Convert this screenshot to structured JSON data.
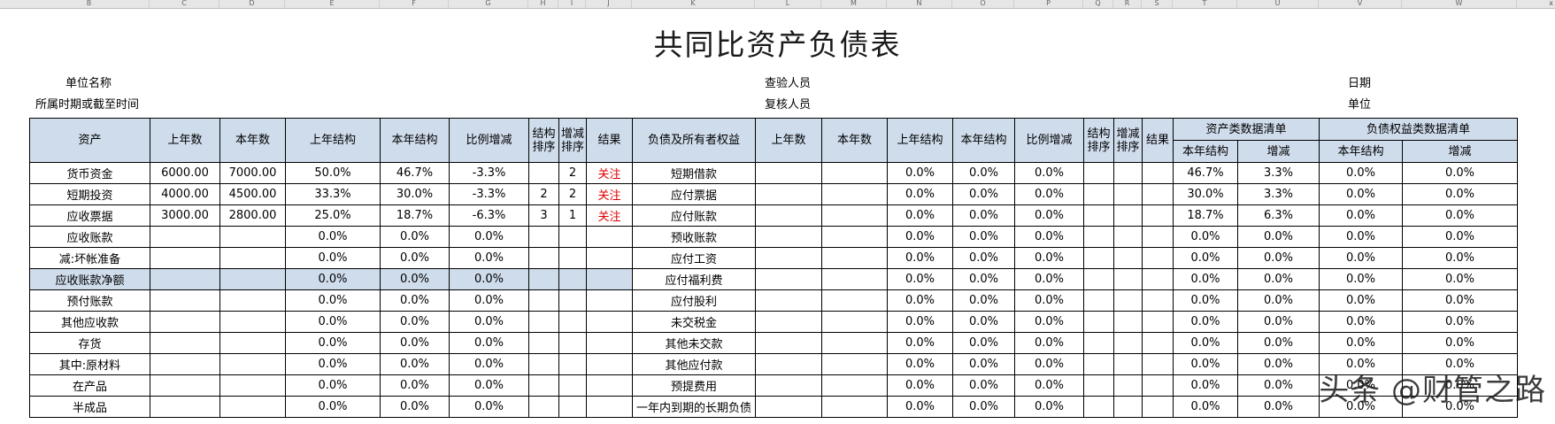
{
  "column_letters": [
    "B",
    "C",
    "D",
    "E",
    "F",
    "G",
    "H",
    "I",
    "J",
    "K",
    "L",
    "M",
    "N",
    "O",
    "P",
    "Q",
    "R",
    "S",
    "T",
    "U",
    "V",
    "W"
  ],
  "close_glyph": "x",
  "title": "共同比资产负债表",
  "meta": {
    "unit_name": "单位名称",
    "period": "所属时期或截至时间",
    "checker": "查验人员",
    "reviewer": "复核人员",
    "date": "日期",
    "unit": "单位"
  },
  "headers": {
    "asset": "资产",
    "prev_amount": "上年数",
    "curr_amount": "本年数",
    "prev_struct": "上年结构",
    "curr_struct": "本年结构",
    "ratio_change": "比例增减",
    "struct_rank": "结构排序",
    "change_rank": "增减排序",
    "result": "结果",
    "liability": "负债及所有者权益",
    "asset_list": "资产类数据清单",
    "liab_list": "负债权益类数据清单",
    "list_struct": "本年结构",
    "list_change": "增减"
  },
  "rows": [
    {
      "asset": "货币资金",
      "prev": "6000.00",
      "curr": "7000.00",
      "ps": "50.0%",
      "cs": "46.7%",
      "chg": "-3.3%",
      "sr": "",
      "cr": "2",
      "res": "关注",
      "liab": "短期借款",
      "lprev": "",
      "lcurr": "",
      "lps": "0.0%",
      "lcs": "0.0%",
      "lchg": "0.0%",
      "lsr": "",
      "lcr": "",
      "lres": "",
      "as": "46.7%",
      "ac": "3.3%",
      "ls": "0.0%",
      "lc": "0.0%"
    },
    {
      "asset": "短期投资",
      "prev": "4000.00",
      "curr": "4500.00",
      "ps": "33.3%",
      "cs": "30.0%",
      "chg": "-3.3%",
      "sr": "2",
      "cr": "2",
      "res": "关注",
      "liab": "应付票据",
      "lprev": "",
      "lcurr": "",
      "lps": "0.0%",
      "lcs": "0.0%",
      "lchg": "0.0%",
      "lsr": "",
      "lcr": "",
      "lres": "",
      "as": "30.0%",
      "ac": "3.3%",
      "ls": "0.0%",
      "lc": "0.0%"
    },
    {
      "asset": "应收票据",
      "prev": "3000.00",
      "curr": "2800.00",
      "ps": "25.0%",
      "cs": "18.7%",
      "chg": "-6.3%",
      "sr": "3",
      "cr": "1",
      "res": "关注",
      "liab": "应付账款",
      "lprev": "",
      "lcurr": "",
      "lps": "0.0%",
      "lcs": "0.0%",
      "lchg": "0.0%",
      "lsr": "",
      "lcr": "",
      "lres": "",
      "as": "18.7%",
      "ac": "6.3%",
      "ls": "0.0%",
      "lc": "0.0%"
    },
    {
      "asset": "应收账款",
      "prev": "",
      "curr": "",
      "ps": "0.0%",
      "cs": "0.0%",
      "chg": "0.0%",
      "sr": "",
      "cr": "",
      "res": "",
      "liab": "预收账款",
      "lprev": "",
      "lcurr": "",
      "lps": "0.0%",
      "lcs": "0.0%",
      "lchg": "0.0%",
      "lsr": "",
      "lcr": "",
      "lres": "",
      "as": "0.0%",
      "ac": "0.0%",
      "ls": "0.0%",
      "lc": "0.0%"
    },
    {
      "asset": "减:坏帐准备",
      "prev": "",
      "curr": "",
      "ps": "0.0%",
      "cs": "0.0%",
      "chg": "0.0%",
      "sr": "",
      "cr": "",
      "res": "",
      "liab": "应付工资",
      "lprev": "",
      "lcurr": "",
      "lps": "0.0%",
      "lcs": "0.0%",
      "lchg": "0.0%",
      "lsr": "",
      "lcr": "",
      "lres": "",
      "as": "0.0%",
      "ac": "0.0%",
      "ls": "0.0%",
      "lc": "0.0%"
    },
    {
      "asset": "应收账款净额",
      "prev": "",
      "curr": "",
      "ps": "0.0%",
      "cs": "0.0%",
      "chg": "0.0%",
      "sr": "",
      "cr": "",
      "res": "",
      "liab": "应付福利费",
      "lprev": "",
      "lcurr": "",
      "lps": "0.0%",
      "lcs": "0.0%",
      "lchg": "0.0%",
      "lsr": "",
      "lcr": "",
      "lres": "",
      "as": "0.0%",
      "ac": "0.0%",
      "ls": "0.0%",
      "lc": "0.0%"
    },
    {
      "asset": "预付账款",
      "prev": "",
      "curr": "",
      "ps": "0.0%",
      "cs": "0.0%",
      "chg": "0.0%",
      "sr": "",
      "cr": "",
      "res": "",
      "liab": "应付股利",
      "lprev": "",
      "lcurr": "",
      "lps": "0.0%",
      "lcs": "0.0%",
      "lchg": "0.0%",
      "lsr": "",
      "lcr": "",
      "lres": "",
      "as": "0.0%",
      "ac": "0.0%",
      "ls": "0.0%",
      "lc": "0.0%"
    },
    {
      "asset": "其他应收款",
      "prev": "",
      "curr": "",
      "ps": "0.0%",
      "cs": "0.0%",
      "chg": "0.0%",
      "sr": "",
      "cr": "",
      "res": "",
      "liab": "未交税金",
      "lprev": "",
      "lcurr": "",
      "lps": "0.0%",
      "lcs": "0.0%",
      "lchg": "0.0%",
      "lsr": "",
      "lcr": "",
      "lres": "",
      "as": "0.0%",
      "ac": "0.0%",
      "ls": "0.0%",
      "lc": "0.0%"
    },
    {
      "asset": "存货",
      "prev": "",
      "curr": "",
      "ps": "0.0%",
      "cs": "0.0%",
      "chg": "0.0%",
      "sr": "",
      "cr": "",
      "res": "",
      "liab": "其他未交款",
      "lprev": "",
      "lcurr": "",
      "lps": "0.0%",
      "lcs": "0.0%",
      "lchg": "0.0%",
      "lsr": "",
      "lcr": "",
      "lres": "",
      "as": "0.0%",
      "ac": "0.0%",
      "ls": "0.0%",
      "lc": "0.0%"
    },
    {
      "asset": "其中:原材料",
      "prev": "",
      "curr": "",
      "ps": "0.0%",
      "cs": "0.0%",
      "chg": "0.0%",
      "sr": "",
      "cr": "",
      "res": "",
      "liab": "其他应付款",
      "lprev": "",
      "lcurr": "",
      "lps": "0.0%",
      "lcs": "0.0%",
      "lchg": "0.0%",
      "lsr": "",
      "lcr": "",
      "lres": "",
      "as": "0.0%",
      "ac": "0.0%",
      "ls": "0.0%",
      "lc": "0.0%"
    },
    {
      "asset": "在产品",
      "prev": "",
      "curr": "",
      "ps": "0.0%",
      "cs": "0.0%",
      "chg": "0.0%",
      "sr": "",
      "cr": "",
      "res": "",
      "liab": "预提费用",
      "lprev": "",
      "lcurr": "",
      "lps": "0.0%",
      "lcs": "0.0%",
      "lchg": "0.0%",
      "lsr": "",
      "lcr": "",
      "lres": "",
      "as": "0.0%",
      "ac": "0.0%",
      "ls": "0.0%",
      "lc": "0.0%"
    },
    {
      "asset": "半成品",
      "prev": "",
      "curr": "",
      "ps": "0.0%",
      "cs": "0.0%",
      "chg": "0.0%",
      "sr": "",
      "cr": "",
      "res": "",
      "liab": "一年内到期的长期负债",
      "lprev": "",
      "lcurr": "",
      "lps": "0.0%",
      "lcs": "0.0%",
      "lchg": "0.0%",
      "lsr": "",
      "lcr": "",
      "lres": "",
      "as": "0.0%",
      "ac": "0.0%",
      "ls": "0.0%",
      "lc": "0.0%"
    }
  ],
  "watermark": "头条 @财管之路",
  "colors": {
    "header_bg": "#cfdcec",
    "highlight_bg": "#cfdcec",
    "attention_red": "#e00000"
  }
}
